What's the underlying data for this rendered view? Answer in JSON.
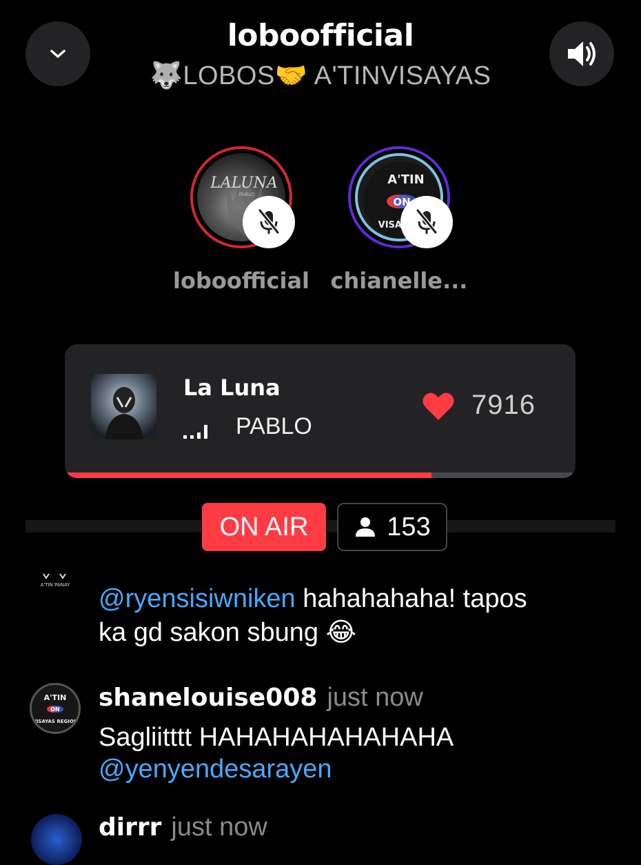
{
  "header": {
    "title": "loboofficial",
    "subtitle": "🐺LOBOS🤝 A'TINVISAYAS",
    "collapse_icon": "chevron-down-icon",
    "volume_icon": "speaker-volume-icon"
  },
  "speakers": [
    {
      "name": "loboofficial",
      "avatar_text": "LALUNA",
      "avatar_sub": "PABLO",
      "ring_color": "#d12a2f",
      "mic_icon": "mic-off-icon"
    },
    {
      "name": "chianelle...",
      "avatar_text": "A'TIN",
      "avatar_sub": "VISAYAS",
      "ring_color": "#5b2ed6",
      "mic_icon": "mic-off-icon"
    }
  ],
  "now_playing": {
    "title": "La Luna",
    "artist": "PABLO",
    "likes": "7916",
    "progress": 0.72,
    "accent": "#ff3b44"
  },
  "status": {
    "on_air": "ON AIR",
    "listeners": "153"
  },
  "comments": [
    {
      "avatar_text": "A'TIN PANAY",
      "mention": "@ryensisiwniken",
      "text": " hahahahaha! tapos",
      "text2": "ka gd sakon sbung 😂"
    },
    {
      "username": "shanelouise008",
      "time": "just now",
      "text": "Sagliitttt HAHAHAHAHAHAHA",
      "mention": "@yenyendesarayen"
    },
    {
      "username": "dirrr",
      "time": "just now"
    }
  ]
}
